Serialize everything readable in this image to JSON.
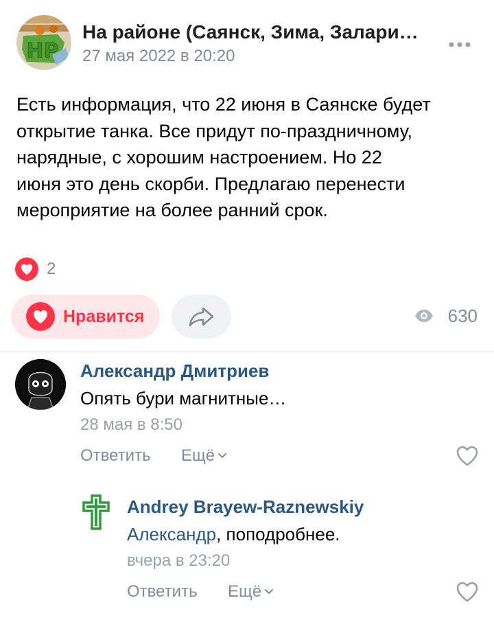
{
  "post": {
    "group_name": "На районе (Саянск, Зима, Залари…",
    "date": "27 мая 2022 в 20:20",
    "text": "Есть информация, что 22 июня в Саянске будет\nоткрытие танка. Все придут по-праздничному,\nнарядные, с хорошим настроением. Но 22\nиюня это день скорби. Предлагаю перенести\nмероприятие на более ранний срок.",
    "reaction_count": "2",
    "like_label": "Нравится",
    "views_count": "630",
    "avatar_logo_text": "НР"
  },
  "comments": [
    {
      "author": "Александр Дмитриев",
      "text": "Опять бури магнитные…",
      "date": "28 мая в 8:50",
      "reply_label": "Ответить",
      "more_label": "Ещё"
    }
  ],
  "reply": {
    "author": "Andrey Brayew-Raznewskiy",
    "mention": "Александр",
    "text": ", поподробнее.",
    "date": "вчера в 23:20",
    "reply_label": "Ответить",
    "more_label": "Ещё"
  },
  "colors": {
    "accent_red": "#ff3347",
    "link_blue": "#2a5885",
    "secondary_text": "#818c99",
    "cross_green": "#2e9e3a"
  },
  "icons": [
    "more-icon",
    "heart-icon",
    "share-icon",
    "eye-icon",
    "chevron-down-icon",
    "heart-outline-icon",
    "cross-icon"
  ]
}
